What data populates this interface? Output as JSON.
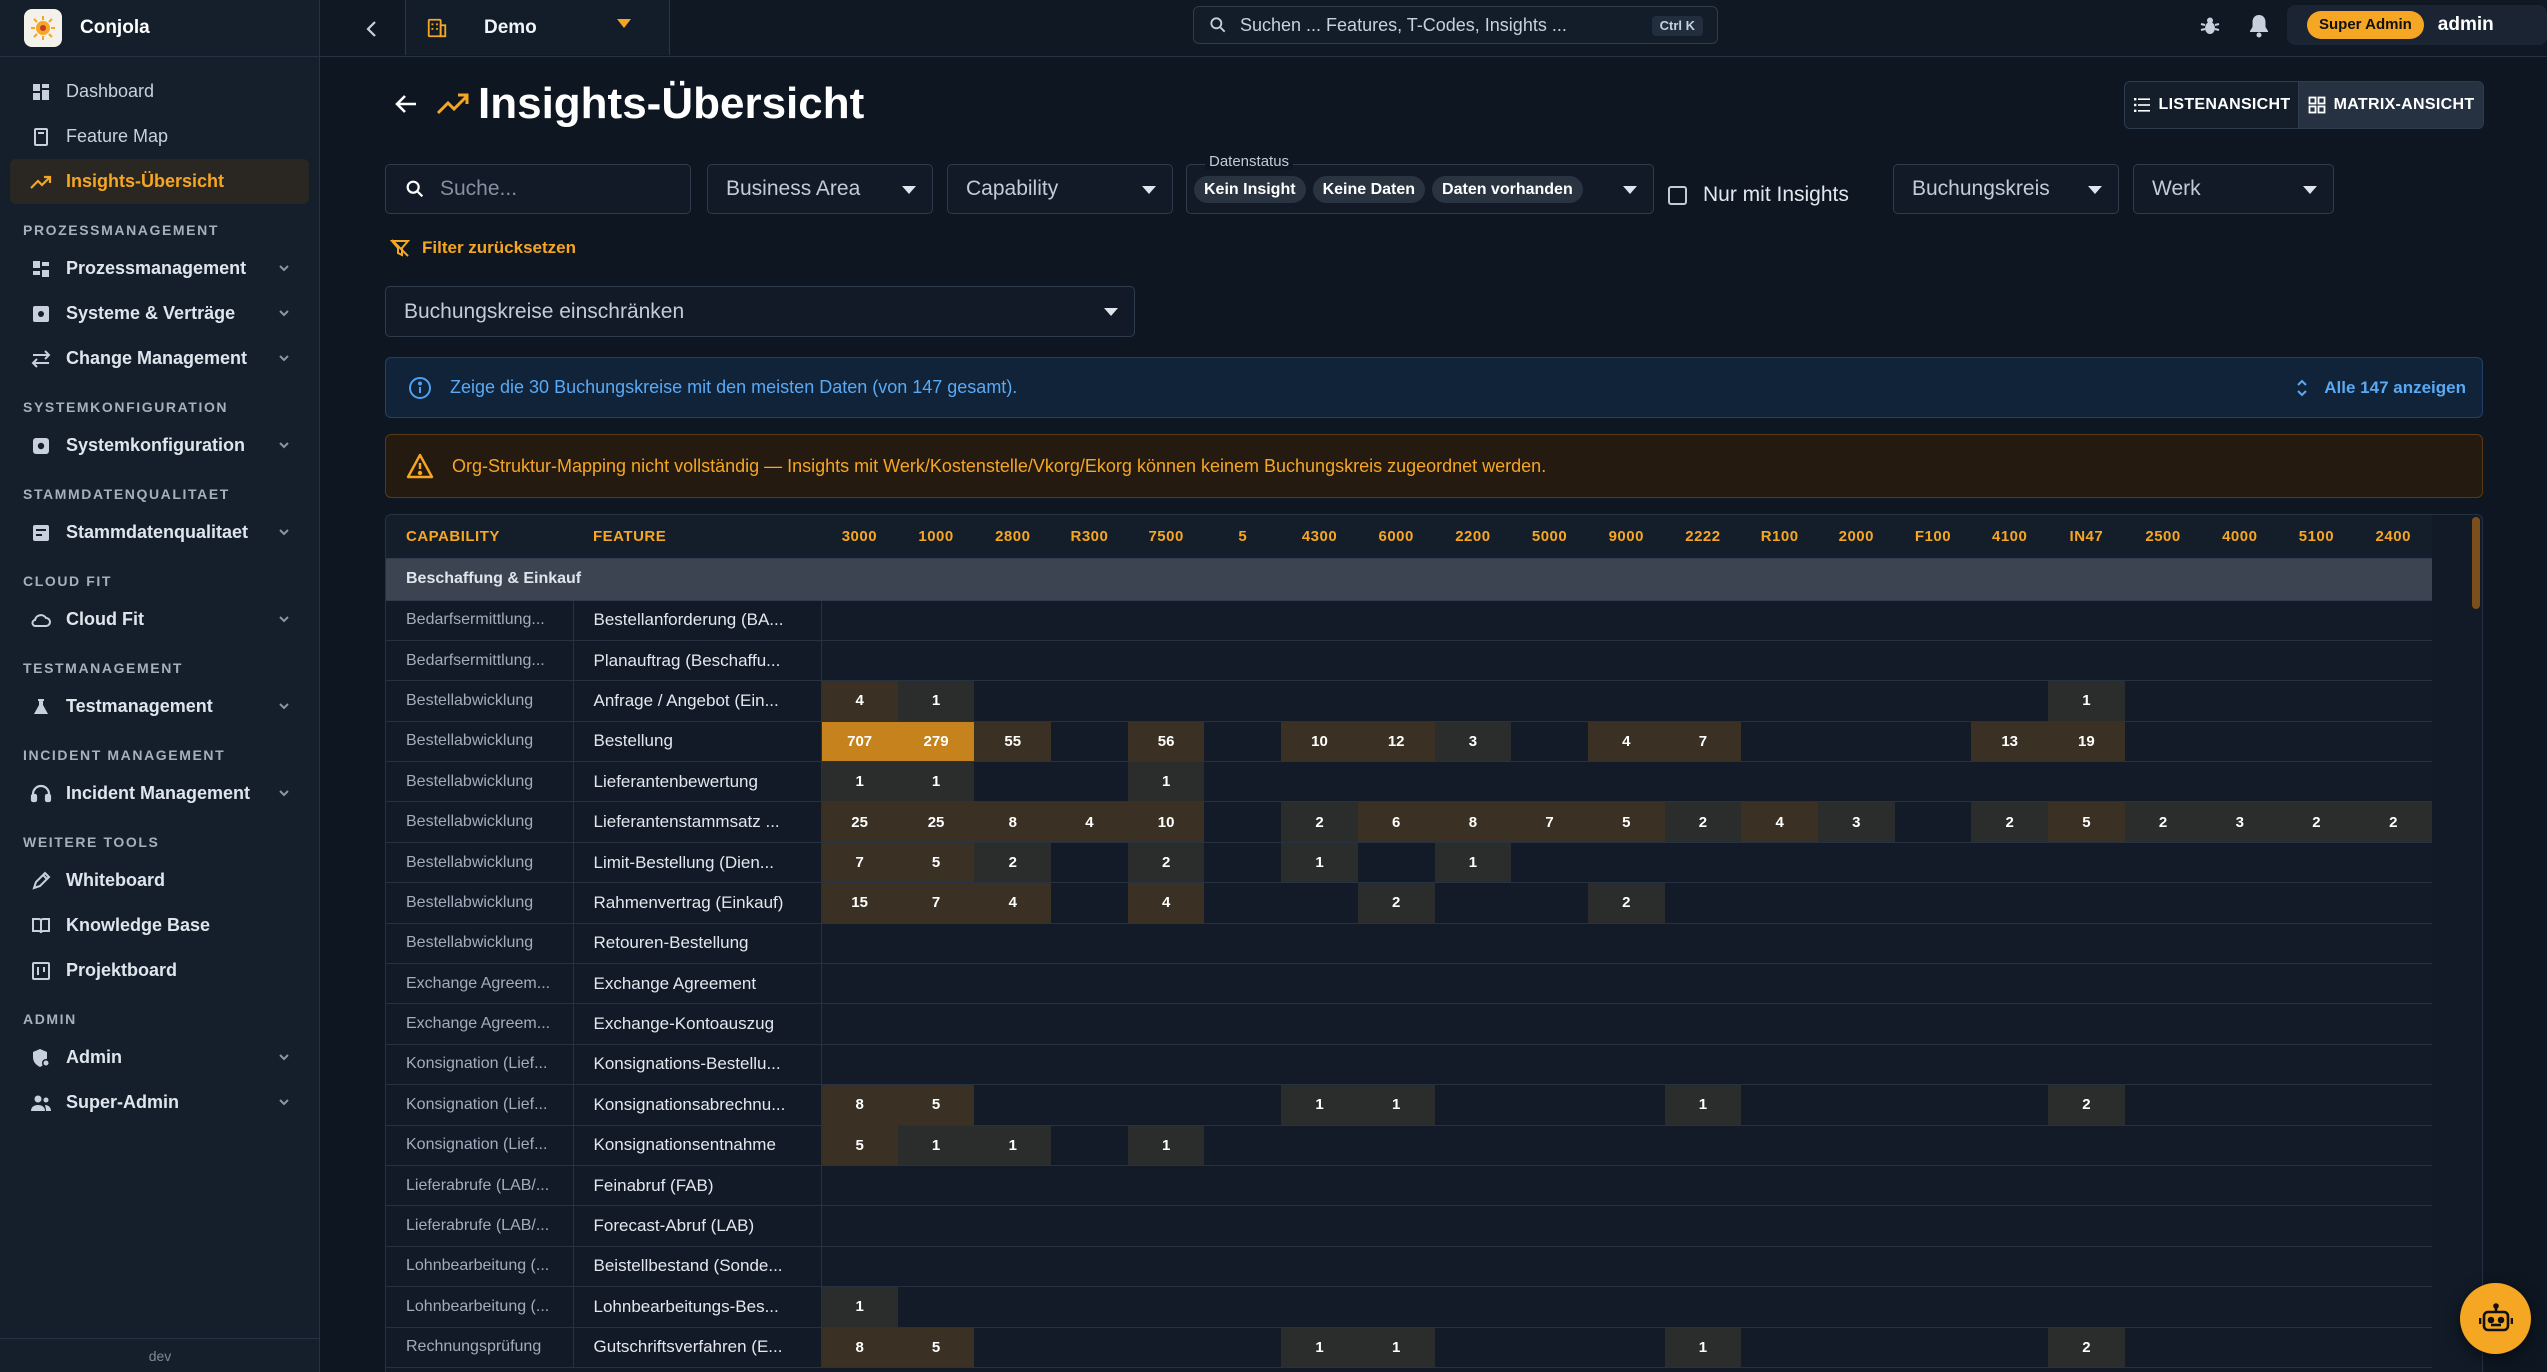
{
  "brand": {
    "name": "Conjola"
  },
  "sidebar": {
    "top_items": [
      {
        "label": "Dashboard",
        "icon": "grid-icon"
      },
      {
        "label": "Feature Map",
        "icon": "map-icon"
      },
      {
        "label": "Insights-Übersicht",
        "icon": "trending-icon",
        "active": true
      }
    ],
    "sections": [
      {
        "title": "PROZESSMANAGEMENT",
        "items": [
          {
            "label": "Prozessmanagement",
            "icon": "process-icon",
            "expandable": true
          },
          {
            "label": "Systeme & Verträge",
            "icon": "system-icon",
            "expandable": true
          },
          {
            "label": "Change Management",
            "icon": "swap-icon",
            "expandable": true
          }
        ]
      },
      {
        "title": "SYSTEMKONFIGURATION",
        "items": [
          {
            "label": "Systemkonfiguration",
            "icon": "gear-icon",
            "expandable": true
          }
        ]
      },
      {
        "title": "STAMMDATENQUALITAET",
        "items": [
          {
            "label": "Stammdatenqualitaet",
            "icon": "data-icon",
            "expandable": true
          }
        ]
      },
      {
        "title": "CLOUD FIT",
        "items": [
          {
            "label": "Cloud Fit",
            "icon": "cloud-icon",
            "expandable": true
          }
        ]
      },
      {
        "title": "TESTMANAGEMENT",
        "items": [
          {
            "label": "Testmanagement",
            "icon": "flask-icon",
            "expandable": true
          }
        ]
      },
      {
        "title": "INCIDENT MANAGEMENT",
        "items": [
          {
            "label": "Incident Management",
            "icon": "headset-icon",
            "expandable": true
          }
        ]
      },
      {
        "title": "WEITERE TOOLS",
        "items": [
          {
            "label": "Whiteboard",
            "icon": "pen-icon",
            "expandable": false
          },
          {
            "label": "Knowledge Base",
            "icon": "book-icon",
            "expandable": false
          },
          {
            "label": "Projektboard",
            "icon": "board-icon",
            "expandable": false
          }
        ]
      },
      {
        "title": "ADMIN",
        "items": [
          {
            "label": "Admin",
            "icon": "shield-gear-icon",
            "expandable": true
          },
          {
            "label": "Super-Admin",
            "icon": "users-icon",
            "expandable": true
          }
        ]
      }
    ],
    "footer": "dev"
  },
  "topbar": {
    "project": "Demo",
    "search_placeholder": "Suchen ... Features, T-Codes, Insights ...",
    "shortcut": "Ctrl K",
    "role_badge": "Super Admin",
    "username": "admin"
  },
  "page": {
    "title": "Insights-Übersicht",
    "view_list": "LISTENANSICHT",
    "view_matrix": "MATRIX-ANSICHT",
    "active_view": "matrix"
  },
  "filters": {
    "search_placeholder": "Suche...",
    "business_area": "Business Area",
    "capability": "Capability",
    "status_label": "Datenstatus",
    "status_chips": [
      "Kein Insight",
      "Keine Daten",
      "Daten vorhanden"
    ],
    "only_insights": "Nur mit Insights",
    "buchungskreis": "Buchungskreis",
    "werk": "Werk",
    "reset": "Filter zurücksetzen",
    "limit_placeholder": "Buchungskreise einschränken"
  },
  "info": {
    "text": "Zeige die 30 Buchungskreise mit den meisten Daten (von 147 gesamt).",
    "action": "Alle 147 anzeigen"
  },
  "warning": {
    "text": "Org-Struktur-Mapping nicht vollständig — Insights mit Werk/Kostenstelle/Vkorg/Ekorg können keinem Buchungskreis zugeordnet werden."
  },
  "matrix": {
    "headers": {
      "capability": "CAPABILITY",
      "feature": "FEATURE"
    },
    "columns": [
      "3000",
      "1000",
      "2800",
      "R300",
      "7500",
      "5",
      "4300",
      "6000",
      "2200",
      "5000",
      "9000",
      "2222",
      "R100",
      "2000",
      "F100",
      "4100",
      "IN47",
      "2500",
      "4000",
      "5100",
      "2400"
    ],
    "group": "Beschaffung & Einkauf",
    "rows": [
      {
        "cap": "Bedarfsermittlung...",
        "feat": "Bestellanforderung (BA...",
        "vals": [
          null,
          null,
          null,
          null,
          null,
          null,
          null,
          null,
          null,
          null,
          null,
          null,
          null,
          null,
          null,
          null,
          null,
          null,
          null,
          null,
          null
        ]
      },
      {
        "cap": "Bedarfsermittlung...",
        "feat": "Planauftrag (Beschaffu...",
        "vals": [
          null,
          null,
          null,
          null,
          null,
          null,
          null,
          null,
          null,
          null,
          null,
          null,
          null,
          null,
          null,
          null,
          null,
          null,
          null,
          null,
          null
        ]
      },
      {
        "cap": "Bestellabwicklung",
        "feat": "Anfrage / Angebot (Ein...",
        "vals": [
          4,
          1,
          null,
          null,
          null,
          null,
          null,
          null,
          null,
          null,
          null,
          null,
          null,
          null,
          null,
          null,
          1,
          null,
          null,
          null,
          null
        ]
      },
      {
        "cap": "Bestellabwicklung",
        "feat": "Bestellung",
        "vals": [
          707,
          279,
          55,
          null,
          56,
          null,
          10,
          12,
          3,
          null,
          4,
          7,
          null,
          null,
          null,
          13,
          19,
          null,
          null,
          null,
          null
        ]
      },
      {
        "cap": "Bestellabwicklung",
        "feat": "Lieferantenbewertung",
        "vals": [
          1,
          1,
          null,
          null,
          1,
          null,
          null,
          null,
          null,
          null,
          null,
          null,
          null,
          null,
          null,
          null,
          null,
          null,
          null,
          null,
          null
        ]
      },
      {
        "cap": "Bestellabwicklung",
        "feat": "Lieferantenstammsatz ...",
        "vals": [
          25,
          25,
          8,
          4,
          10,
          null,
          2,
          6,
          8,
          7,
          5,
          2,
          4,
          3,
          null,
          2,
          5,
          2,
          3,
          2,
          2
        ]
      },
      {
        "cap": "Bestellabwicklung",
        "feat": "Limit-Bestellung (Dien...",
        "vals": [
          7,
          5,
          2,
          null,
          2,
          null,
          1,
          null,
          1,
          null,
          null,
          null,
          null,
          null,
          null,
          null,
          null,
          null,
          null,
          null,
          null
        ]
      },
      {
        "cap": "Bestellabwicklung",
        "feat": "Rahmenvertrag (Einkauf)",
        "vals": [
          15,
          7,
          4,
          null,
          4,
          null,
          null,
          2,
          null,
          null,
          2,
          null,
          null,
          null,
          null,
          null,
          null,
          null,
          null,
          null,
          null
        ]
      },
      {
        "cap": "Bestellabwicklung",
        "feat": "Retouren-Bestellung",
        "vals": [
          null,
          null,
          null,
          null,
          null,
          null,
          null,
          null,
          null,
          null,
          null,
          null,
          null,
          null,
          null,
          null,
          null,
          null,
          null,
          null,
          null
        ]
      },
      {
        "cap": "Exchange Agreem...",
        "feat": "Exchange Agreement",
        "vals": [
          null,
          null,
          null,
          null,
          null,
          null,
          null,
          null,
          null,
          null,
          null,
          null,
          null,
          null,
          null,
          null,
          null,
          null,
          null,
          null,
          null
        ]
      },
      {
        "cap": "Exchange Agreem...",
        "feat": "Exchange-Kontoauszug",
        "vals": [
          null,
          null,
          null,
          null,
          null,
          null,
          null,
          null,
          null,
          null,
          null,
          null,
          null,
          null,
          null,
          null,
          null,
          null,
          null,
          null,
          null
        ]
      },
      {
        "cap": "Konsignation (Lief...",
        "feat": "Konsignations-Bestellu...",
        "vals": [
          null,
          null,
          null,
          null,
          null,
          null,
          null,
          null,
          null,
          null,
          null,
          null,
          null,
          null,
          null,
          null,
          null,
          null,
          null,
          null,
          null
        ]
      },
      {
        "cap": "Konsignation (Lief...",
        "feat": "Konsignationsabrechnu...",
        "vals": [
          8,
          5,
          null,
          null,
          null,
          null,
          1,
          1,
          null,
          null,
          null,
          1,
          null,
          null,
          null,
          null,
          2,
          null,
          null,
          null,
          null
        ]
      },
      {
        "cap": "Konsignation (Lief...",
        "feat": "Konsignationsentnahme",
        "vals": [
          5,
          1,
          1,
          null,
          1,
          null,
          null,
          null,
          null,
          null,
          null,
          null,
          null,
          null,
          null,
          null,
          null,
          null,
          null,
          null,
          null
        ]
      },
      {
        "cap": "Lieferabrufe (LAB/...",
        "feat": "Feinabruf (FAB)",
        "vals": [
          null,
          null,
          null,
          null,
          null,
          null,
          null,
          null,
          null,
          null,
          null,
          null,
          null,
          null,
          null,
          null,
          null,
          null,
          null,
          null,
          null
        ]
      },
      {
        "cap": "Lieferabrufe (LAB/...",
        "feat": "Forecast-Abruf (LAB)",
        "vals": [
          null,
          null,
          null,
          null,
          null,
          null,
          null,
          null,
          null,
          null,
          null,
          null,
          null,
          null,
          null,
          null,
          null,
          null,
          null,
          null,
          null
        ]
      },
      {
        "cap": "Lohnbearbeitung (...",
        "feat": "Beistellbestand (Sonde...",
        "vals": [
          null,
          null,
          null,
          null,
          null,
          null,
          null,
          null,
          null,
          null,
          null,
          null,
          null,
          null,
          null,
          null,
          null,
          null,
          null,
          null,
          null
        ]
      },
      {
        "cap": "Lohnbearbeitung (...",
        "feat": "Lohnbearbeitungs-Bes...",
        "vals": [
          1,
          null,
          null,
          null,
          null,
          null,
          null,
          null,
          null,
          null,
          null,
          null,
          null,
          null,
          null,
          null,
          null,
          null,
          null,
          null,
          null
        ]
      },
      {
        "cap": "Rechnungsprüfung",
        "feat": "Gutschriftsverfahren (E...",
        "vals": [
          8,
          5,
          null,
          null,
          null,
          null,
          1,
          1,
          null,
          null,
          null,
          1,
          null,
          null,
          null,
          null,
          2,
          null,
          null,
          null,
          null
        ]
      }
    ]
  },
  "colors": {
    "accent": "#f5a623",
    "info": "#5aa9f4",
    "bg": "#0d1621"
  }
}
